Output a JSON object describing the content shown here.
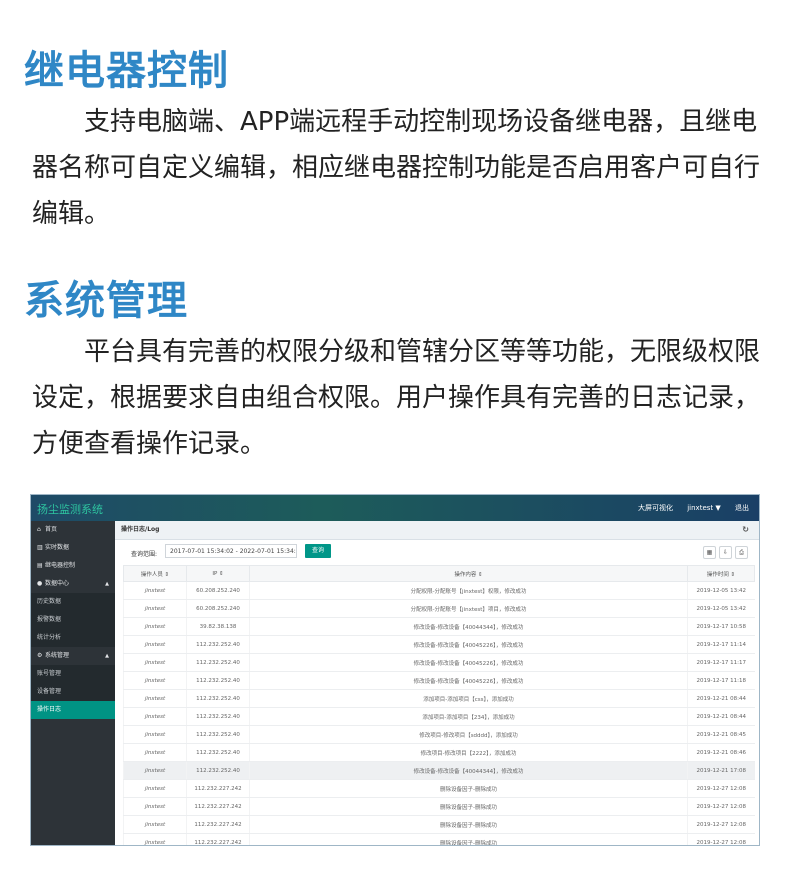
{
  "section1": {
    "title": "继电器控制",
    "text": "支持电脑端、APP端远程手动控制现场设备继电器，且继电器名称可自定义编辑，相应继电器控制功能是否启用客户可自行编辑。"
  },
  "section2": {
    "title": "系统管理",
    "text": "平台具有完善的权限分级和管辖分区等等功能，无限级权限设定，根据要求自由组合权限。用户操作具有完善的日志记录，方便查看操作记录。"
  },
  "app": {
    "logo": "扬尘监测系统",
    "topbar": {
      "screen_link": "大屏可视化",
      "user": "jinxtest ▼",
      "logout": "退出"
    },
    "sidebar": [
      {
        "icon": "home-icon",
        "glyph": "⌂",
        "label": "首页",
        "type": "top"
      },
      {
        "icon": "chart-icon",
        "glyph": "▥",
        "label": "实时数据",
        "type": "top"
      },
      {
        "icon": "relay-icon",
        "glyph": "▤",
        "label": "继电器控制",
        "type": "top"
      },
      {
        "icon": "data-center-icon",
        "glyph": "●",
        "label": "数据中心",
        "type": "top",
        "caret": "▲"
      },
      {
        "label": "历史数据",
        "type": "sub"
      },
      {
        "label": "报警数据",
        "type": "sub"
      },
      {
        "label": "统计分析",
        "type": "sub"
      },
      {
        "icon": "settings-icon",
        "glyph": "⚙",
        "label": "系统管理",
        "type": "top",
        "caret": "▲"
      },
      {
        "label": "账号管理",
        "type": "sub"
      },
      {
        "label": "设备管理",
        "type": "sub"
      },
      {
        "label": "操作日志",
        "type": "sub",
        "active": true
      }
    ],
    "panel_title": "操作日志/Log",
    "query": {
      "label": "查询范围:",
      "value": "2017-07-01 15:34:02 - 2022-07-01 15:34:02",
      "button": "查询"
    },
    "columns": [
      "操作人员 ⇕",
      "IP ⇕",
      "操作内容 ⇕",
      "操作时间 ⇕"
    ],
    "rows": [
      [
        "jinxtest",
        "60.208.252.240",
        "分配权限-分配账号【jinxtest】权限，修改成功",
        "2019-12-05 13:42",
        false
      ],
      [
        "jinxtest",
        "60.208.252.240",
        "分配权限-分配账号【jinxtest】项目，修改成功",
        "2019-12-05 13:42",
        false
      ],
      [
        "jinxtest",
        "39.82.38.138",
        "修改设备-修改设备【40044344】，修改成功",
        "2019-12-17 10:58",
        false
      ],
      [
        "jinxtest",
        "112.232.252.40",
        "修改设备-修改设备【40045226】，修改成功",
        "2019-12-17 11:14",
        false
      ],
      [
        "jinxtest",
        "112.232.252.40",
        "修改设备-修改设备【40045226】，修改成功",
        "2019-12-17 11:17",
        false
      ],
      [
        "jinxtest",
        "112.232.252.40",
        "修改设备-修改设备【40045226】，修改成功",
        "2019-12-17 11:18",
        false
      ],
      [
        "jinxtest",
        "112.232.252.40",
        "添加项目-添加项目【css】，添加成功",
        "2019-12-21 08:44",
        false
      ],
      [
        "jinxtest",
        "112.232.252.40",
        "添加项目-添加项目【234】，添加成功",
        "2019-12-21 08:44",
        false
      ],
      [
        "jinxtest",
        "112.232.252.40",
        "修改项目-修改项目【sdddd】，添加成功",
        "2019-12-21 08:45",
        false
      ],
      [
        "jinxtest",
        "112.232.252.40",
        "修改项目-修改项目【2222】，添加成功",
        "2019-12-21 08:46",
        false
      ],
      [
        "jinxtest",
        "112.232.252.40",
        "修改设备-修改设备【40044344】，修改成功",
        "2019-12-21 17:08",
        true
      ],
      [
        "jinxtest",
        "112.232.227.242",
        "删除设备因子-删除成功",
        "2019-12-27 12:08",
        false
      ],
      [
        "jinxtest",
        "112.232.227.242",
        "删除设备因子-删除成功",
        "2019-12-27 12:08",
        false
      ],
      [
        "jinxtest",
        "112.232.227.242",
        "删除设备因子-删除成功",
        "2019-12-27 12:08",
        false
      ],
      [
        "jinxtest",
        "112.232.227.242",
        "删除设备因子-删除成功",
        "2019-12-27 12:08",
        false
      ]
    ],
    "tools": [
      {
        "icon": "grid-icon",
        "glyph": "▦"
      },
      {
        "icon": "export-icon",
        "glyph": "⇩"
      },
      {
        "icon": "print-icon",
        "glyph": "⎙"
      }
    ]
  }
}
